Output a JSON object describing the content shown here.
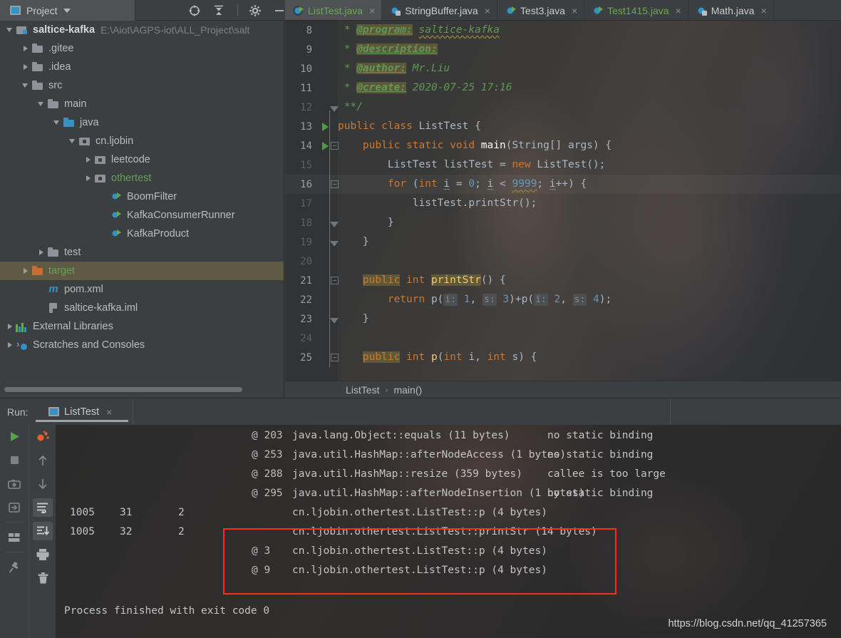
{
  "window": {
    "toolwindow_tab": "Project",
    "toolbar_icons": [
      "locate-icon",
      "collapse-all-icon",
      "settings-gear-icon",
      "minimize-icon"
    ]
  },
  "sidebar": {
    "items": [
      {
        "label": "saltice-kafka",
        "path": "E:\\Aiot\\AGPS-iot\\ALL_Project\\salt",
        "icon": "module-icon",
        "arrow": "down",
        "indent": 0,
        "style": "bold"
      },
      {
        "label": ".gitee",
        "path": "",
        "icon": "folder-icon",
        "arrow": "right",
        "indent": 1,
        "style": "normal"
      },
      {
        "label": ".idea",
        "path": "",
        "icon": "folder-icon",
        "arrow": "right",
        "indent": 1,
        "style": "normal"
      },
      {
        "label": "src",
        "path": "",
        "icon": "folder-icon",
        "arrow": "down",
        "indent": 1,
        "style": "normal"
      },
      {
        "label": "main",
        "path": "",
        "icon": "folder-icon",
        "arrow": "down",
        "indent": 2,
        "style": "normal"
      },
      {
        "label": "java",
        "path": "",
        "icon": "source-folder-icon",
        "arrow": "down",
        "indent": 3,
        "style": "normal"
      },
      {
        "label": "cn.ljobin",
        "path": "",
        "icon": "package-icon",
        "arrow": "down",
        "indent": 4,
        "style": "normal"
      },
      {
        "label": "leetcode",
        "path": "",
        "icon": "package-icon",
        "arrow": "right",
        "indent": 5,
        "style": "normal"
      },
      {
        "label": "othertest",
        "path": "",
        "icon": "package-icon",
        "arrow": "right",
        "indent": 5,
        "style": "green"
      },
      {
        "label": "BoomFilter",
        "path": "",
        "icon": "java-class-runnable-icon",
        "arrow": "none",
        "indent": 6,
        "style": "normal"
      },
      {
        "label": "KafkaConsumerRunner",
        "path": "",
        "icon": "java-class-runnable-icon",
        "arrow": "none",
        "indent": 6,
        "style": "normal"
      },
      {
        "label": "KafkaProduct",
        "path": "",
        "icon": "java-class-runnable-icon",
        "arrow": "none",
        "indent": 6,
        "style": "normal"
      },
      {
        "label": "test",
        "path": "",
        "icon": "folder-icon",
        "arrow": "right",
        "indent": 2,
        "style": "normal"
      },
      {
        "label": "target",
        "path": "",
        "icon": "excluded-folder-icon",
        "arrow": "right",
        "indent": 1,
        "style": "green",
        "selected": true
      },
      {
        "label": "pom.xml",
        "path": "",
        "icon": "maven-icon",
        "arrow": "none",
        "indent": 2,
        "style": "normal"
      },
      {
        "label": "saltice-kafka.iml",
        "path": "",
        "icon": "iml-file-icon",
        "arrow": "none",
        "indent": 2,
        "style": "normal"
      },
      {
        "label": "External Libraries",
        "path": "",
        "icon": "libraries-icon",
        "arrow": "right",
        "indent": 0,
        "style": "normal"
      },
      {
        "label": "Scratches and Consoles",
        "path": "",
        "icon": "scratches-icon",
        "arrow": "right",
        "indent": 0,
        "style": "normal"
      }
    ]
  },
  "editor": {
    "tabs": [
      {
        "label": "ListTest.java",
        "icon": "java-class-runnable-icon",
        "active": true,
        "color": "green"
      },
      {
        "label": "StringBuffer.java",
        "icon": "java-class-locked-icon",
        "active": false,
        "color": "plain"
      },
      {
        "label": "Test3.java",
        "icon": "java-class-runnable-icon",
        "active": false,
        "color": "plain"
      },
      {
        "label": "Test1415.java",
        "icon": "java-class-runnable-icon",
        "active": false,
        "color": "green"
      },
      {
        "label": "Math.java",
        "icon": "java-class-locked-icon",
        "active": false,
        "color": "plain"
      }
    ],
    "close_glyph": "×",
    "first_line_number": 8,
    "lines": [
      {
        "n": 8,
        "text": " * @program: saltice-kafka"
      },
      {
        "n": 9,
        "text": " * @description:"
      },
      {
        "n": 10,
        "text": " * @author: Mr.Liu"
      },
      {
        "n": 11,
        "text": " * @create: 2020-07-25 17:16"
      },
      {
        "n": 12,
        "text": " **/"
      },
      {
        "n": 13,
        "text": "public class ListTest {"
      },
      {
        "n": 14,
        "text": "    public static void main(String[] args) {"
      },
      {
        "n": 15,
        "text": "        ListTest listTest = new ListTest();"
      },
      {
        "n": 16,
        "text": "        for (int i = 0; i < 9999; i++) {"
      },
      {
        "n": 17,
        "text": "            listTest.printStr();"
      },
      {
        "n": 18,
        "text": "        }"
      },
      {
        "n": 19,
        "text": "    }"
      },
      {
        "n": 20,
        "text": ""
      },
      {
        "n": 21,
        "text": "    public int printStr() {"
      },
      {
        "n": 22,
        "text": "        return p( i: 1,  s: 3)+p( i: 2,  s: 4);"
      },
      {
        "n": 23,
        "text": "    }"
      },
      {
        "n": 24,
        "text": ""
      },
      {
        "n": 25,
        "text": "    public int p(int i, int s) {"
      }
    ],
    "inlay_hints": [
      "i:",
      "s:",
      "i:",
      "s:"
    ],
    "breadcrumb": {
      "class": "ListTest",
      "separator": "›",
      "method": "main()"
    }
  },
  "run_panel": {
    "label": "Run:",
    "tab": "ListTest",
    "close_glyph": "×",
    "toolbar_left": [
      "rerun-icon",
      "stop-icon",
      "screenshot-icon",
      "export-icon",
      "layout-icon",
      "pin-icon"
    ],
    "toolbar_right": [
      "profiler-icon",
      "up-arrow-icon",
      "down-arrow-icon",
      "soft-wrap-icon",
      "scroll-to-end-icon",
      "print-icon",
      "trash-icon"
    ],
    "console_lines": [
      {
        "cols": [
          "",
          "",
          "",
          "@ 203",
          "java.lang.Object::equals (11 bytes)",
          "no static binding"
        ]
      },
      {
        "cols": [
          "",
          "",
          "",
          "@ 253",
          "java.util.HashMap::afterNodeAccess (1 bytes)",
          "no static binding"
        ]
      },
      {
        "cols": [
          "",
          "",
          "",
          "@ 288",
          "java.util.HashMap::resize (359 bytes)",
          "callee is too large"
        ]
      },
      {
        "cols": [
          "",
          "",
          "",
          "@ 295",
          "java.util.HashMap::afterNodeInsertion (1 bytes)",
          "no static binding"
        ]
      },
      {
        "cols": [
          "1005",
          "31",
          "2",
          "",
          "cn.ljobin.othertest.ListTest::p (4 bytes)",
          ""
        ]
      },
      {
        "cols": [
          "1005",
          "32",
          "2",
          "",
          "cn.ljobin.othertest.ListTest::printStr (14 bytes)",
          ""
        ]
      },
      {
        "cols": [
          "",
          "",
          "",
          "@ 3",
          "cn.ljobin.othertest.ListTest::p (4 bytes)",
          ""
        ]
      },
      {
        "cols": [
          "",
          "",
          "",
          "@ 9",
          "cn.ljobin.othertest.ListTest::p (4 bytes)",
          ""
        ]
      }
    ],
    "process_finished": "Process finished with exit code 0",
    "highlight_box_color": "#f6301e"
  },
  "watermark": "https://blog.csdn.net/qq_41257365",
  "colors": {
    "background": "#3c3f41",
    "console_background": "#2b2b2b",
    "selection": "#5f5a43",
    "accent_blue": "#3592c4",
    "accent_green": "#6aa84f",
    "keyword_orange": "#cc7832",
    "comment_green": "#629755",
    "highlight_red": "#f6301e"
  }
}
